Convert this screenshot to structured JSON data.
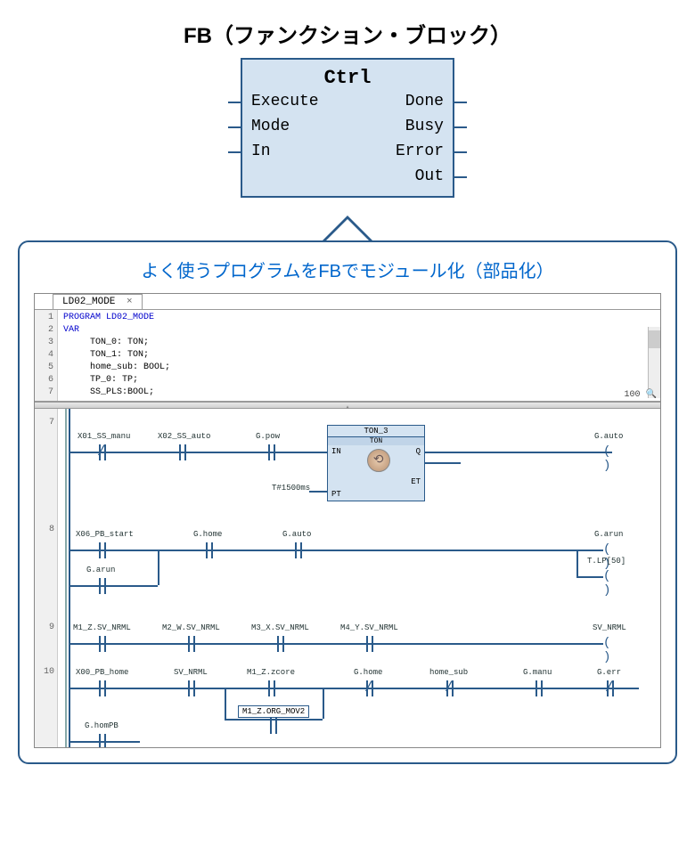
{
  "header": {
    "title": "FB（ファンクション・ブロック）"
  },
  "fb": {
    "name": "Ctrl",
    "inputs": [
      "Execute",
      "Mode",
      "In"
    ],
    "outputs": [
      "Done",
      "Busy",
      "Error",
      "Out"
    ]
  },
  "callout": {
    "title": "よく使うプログラムをFBでモジュール化（部品化）"
  },
  "editor": {
    "tab": "LD02_MODE",
    "zoom": "100",
    "code": {
      "lines": [
        1,
        2,
        3,
        4,
        5,
        6,
        7
      ],
      "program": "PROGRAM LD02_MODE",
      "var": "VAR",
      "decls": [
        "TON_0: TON;",
        "TON_1: TON;",
        "home_sub: BOOL;",
        "TP_0: TP;",
        "SS_PLS:BOOL;"
      ]
    }
  },
  "ladder": {
    "rung_numbers": [
      7,
      8,
      9,
      10
    ],
    "rung7": {
      "contacts": [
        "X01_SS_manu",
        "X02_SS_auto",
        "G.pow"
      ],
      "ton": {
        "name": "TON_3",
        "type": "TON",
        "in": "IN",
        "q": "Q",
        "et": "ET",
        "pt": "PT",
        "preset": "T#1500ms"
      },
      "coil": "G.auto"
    },
    "rung8": {
      "c1": "X06_PB_start",
      "c2": "G.home",
      "c3": "G.auto",
      "branch": "G.arun",
      "coil1": "G.arun",
      "coil2": "T.LP[50]"
    },
    "rung9": {
      "c1": "M1_Z.SV_NRML",
      "c2": "M2_W.SV_NRML",
      "c3": "M3_X.SV_NRML",
      "c4": "M4_Y.SV_NRML",
      "coil": "SV_NRML"
    },
    "rung10": {
      "c1": "X00_PB_home",
      "c2": "SV_NRML",
      "c3": "M1_Z.zcore",
      "c4": "G.home",
      "c5": "home_sub",
      "c6": "G.manu",
      "c7": "G.err",
      "branch_box": "M1_Z.ORG_MOV2",
      "branch2": "G.homPB"
    }
  }
}
